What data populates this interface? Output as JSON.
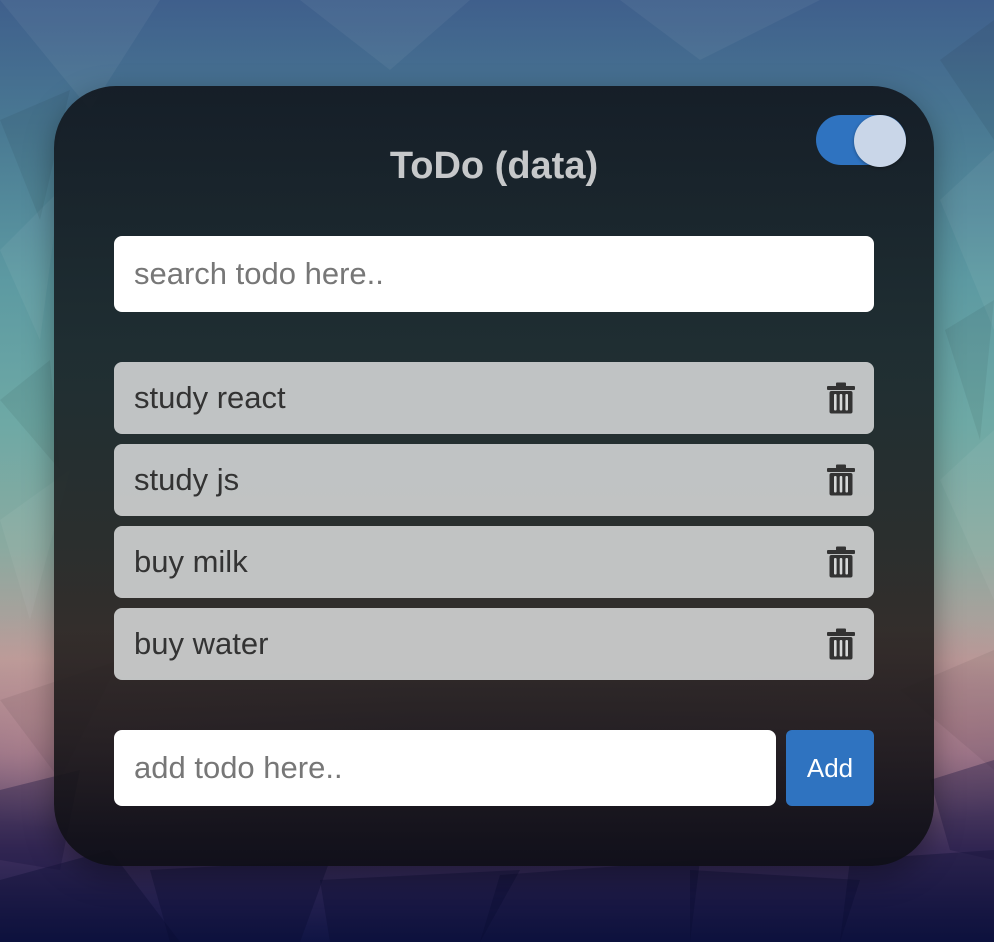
{
  "app": {
    "title": "ToDo (data)"
  },
  "theme_toggle": {
    "state": "on",
    "track_color": "#2f73c0",
    "knob_color": "#c9d6e8"
  },
  "search": {
    "value": "",
    "placeholder": "search todo here.."
  },
  "todos": [
    {
      "text": "study react",
      "delete_icon": "trash-icon"
    },
    {
      "text": "study js",
      "delete_icon": "trash-icon"
    },
    {
      "text": "buy milk",
      "delete_icon": "trash-icon"
    },
    {
      "text": "buy water",
      "delete_icon": "trash-icon"
    }
  ],
  "add_form": {
    "value": "",
    "placeholder": "add todo here..",
    "button_label": "Add"
  },
  "colors": {
    "accent": "#2f73c0",
    "title_text": "#c6c8ca",
    "item_background": "#d6d8d8",
    "item_text": "#333333",
    "icon": "#333333"
  }
}
